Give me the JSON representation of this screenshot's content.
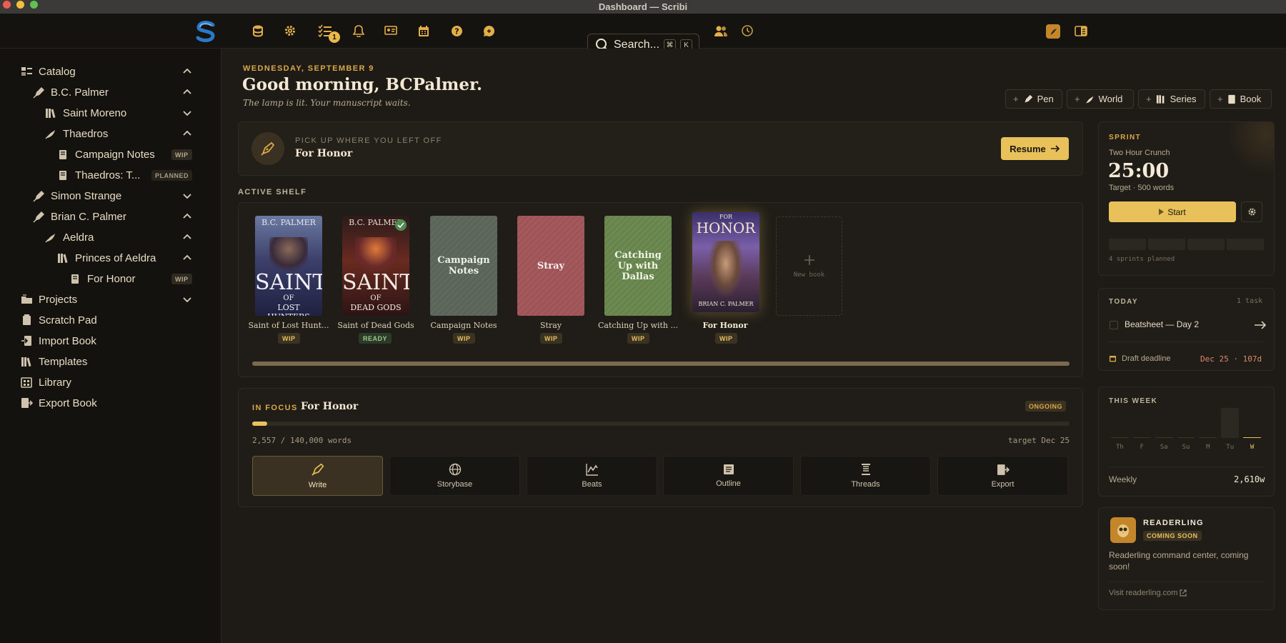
{
  "window": {
    "title": "Dashboard — Scribi"
  },
  "topbar": {
    "badge_count": "1",
    "search_label": "Search...",
    "kbd_cmd": "⌘",
    "kbd_k": "K"
  },
  "sidebar": {
    "items": [
      {
        "label": "Catalog",
        "icon": "catalog-icon"
      },
      {
        "label": "B.C. Palmer",
        "icon": "pen-icon"
      },
      {
        "label": "Saint Moreno",
        "icon": "books-icon"
      },
      {
        "label": "Thaedros",
        "icon": "world-icon"
      },
      {
        "label": "Campaign Notes",
        "icon": "book-icon",
        "tag": "WIP"
      },
      {
        "label": "Thaedros: T...",
        "icon": "book-icon",
        "tag": "PLANNED"
      },
      {
        "label": "Simon Strange",
        "icon": "pen-icon"
      },
      {
        "label": "Brian C. Palmer",
        "icon": "pen-icon"
      },
      {
        "label": "Aeldra",
        "icon": "world-icon"
      },
      {
        "label": "Princes of Aeldra",
        "icon": "books-icon"
      },
      {
        "label": "For Honor",
        "icon": "book-icon",
        "tag": "WIP"
      },
      {
        "label": "Projects",
        "icon": "folder-icon"
      },
      {
        "label": "Scratch Pad",
        "icon": "pad-icon"
      },
      {
        "label": "Import Book",
        "icon": "import-icon"
      },
      {
        "label": "Templates",
        "icon": "books-icon"
      },
      {
        "label": "Library",
        "icon": "library-icon"
      },
      {
        "label": "Export Book",
        "icon": "export-icon"
      }
    ]
  },
  "header": {
    "date": "WEDNESDAY, SEPTEMBER 9",
    "greeting": "Good morning, BCPalmer.",
    "tagline": "The lamp is lit. Your manuscript waits.",
    "buttons": [
      "Pen",
      "World",
      "Series",
      "Book"
    ]
  },
  "resume": {
    "label": "PICK UP WHERE YOU LEFT OFF",
    "title": "For Honor",
    "button": "Resume"
  },
  "shelf": {
    "label": "ACTIVE SHELF",
    "books": [
      {
        "caption": "Saint of Lost Hunt...",
        "status": "WIP",
        "cover_top": "B.C. PALMER",
        "cover_title": "SAINT",
        "cover_of": "OF",
        "cover_sub": "LOST HUNTERS"
      },
      {
        "caption": "Saint of Dead Gods",
        "status": "READY",
        "cover_top": "B.C. PALMER",
        "cover_title": "SAINT",
        "cover_of": "OF",
        "cover_sub": "DEAD GODS"
      },
      {
        "caption": "Campaign Notes",
        "status": "WIP",
        "cover_title": "Campaign Notes"
      },
      {
        "caption": "Stray",
        "status": "WIP",
        "cover_title": "Stray"
      },
      {
        "caption": "Catching Up with ...",
        "status": "WIP",
        "cover_title": "Catching Up with Dallas"
      },
      {
        "caption": "For Honor",
        "status": "WIP",
        "cover_top": "FOR",
        "cover_title": "HONOR",
        "cover_sub": "BRIAN C. PALMER"
      }
    ],
    "new_book": "New book"
  },
  "focus": {
    "label": "IN FOCUS",
    "title": "For Honor",
    "status": "ONGOING",
    "words": "2,557 / 140,000 words",
    "target": "target Dec 25",
    "progress": 0.018,
    "tools": [
      "Write",
      "Storybase",
      "Beats",
      "Outline",
      "Threads",
      "Export"
    ]
  },
  "sprint": {
    "label": "SPRINT",
    "name": "Two Hour Crunch",
    "time": "25:00",
    "target": "Target · 500 words",
    "start": "Start",
    "planned": "4 sprints planned"
  },
  "today": {
    "label": "TODAY",
    "count": "1 task",
    "task": "Beatsheet — Day 2",
    "deadline_label": "Draft deadline",
    "deadline_value": "Dec 25 · 107d"
  },
  "week": {
    "label": "THIS WEEK",
    "days": [
      "Th",
      "F",
      "Sa",
      "Su",
      "M",
      "Tu",
      "W"
    ],
    "values": [
      0,
      0,
      0,
      0,
      0,
      2610,
      0
    ],
    "weekly_label": "Weekly",
    "weekly_value": "2,610w"
  },
  "readerling": {
    "title": "READERLING",
    "badge": "COMING SOON",
    "desc": "Readerling command center, coming soon!",
    "link": "Visit readerling.com"
  },
  "colors": {
    "accent": "#e8c15a",
    "bg": "#1e1b17",
    "panel": "#201d18"
  }
}
